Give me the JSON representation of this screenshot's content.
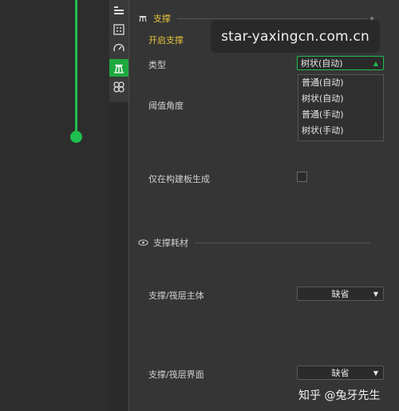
{
  "watermark": "star-yaxingcn.com.cn",
  "credit": "知乎 @兔牙先生",
  "sections": {
    "support": {
      "title": "支撑",
      "enable_label": "开启支撑",
      "type_label": "类型",
      "type_value": "树状(自动)",
      "type_options": [
        "普通(自动)",
        "树状(自动)",
        "普通(手动)",
        "树状(手动)"
      ],
      "threshold_label": "阈值角度",
      "buildplate_label": "仅在构建板生成"
    },
    "filament": {
      "title": "支撑耗材",
      "base_label": "支撑/筏层主体",
      "base_value": "缺省",
      "interface_label": "支撑/筏层界面",
      "interface_value": "缺省"
    }
  },
  "colors": {
    "accent_green": "#1fbf4f",
    "accent_yellow": "#e6c43c"
  },
  "icons": [
    "layers-icon",
    "grid-icon",
    "gauge-icon",
    "support-icon",
    "multi-material-icon",
    "eye-icon"
  ]
}
